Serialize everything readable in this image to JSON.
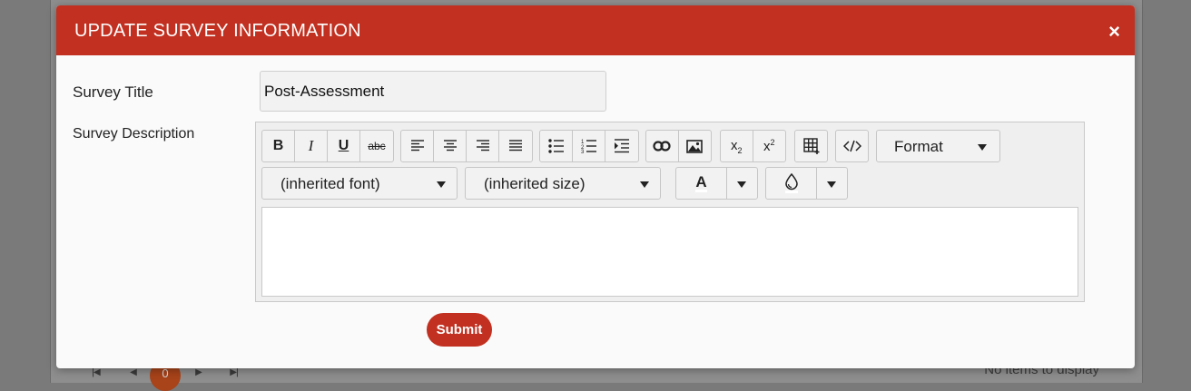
{
  "modal": {
    "title": "UPDATE SURVEY INFORMATION",
    "close_symbol": "×"
  },
  "form": {
    "survey_title_label": "Survey Title",
    "survey_title_value": "Post-Assessment",
    "survey_description_label": "Survey Description",
    "submit_label": "Submit"
  },
  "toolbar": {
    "format_label": "Format",
    "font_family_value": "(inherited font)",
    "font_size_value": "(inherited size)",
    "text_color_glyph": "A",
    "buttons": [
      {
        "name": "bold-icon"
      },
      {
        "name": "italic-icon"
      },
      {
        "name": "underline-icon"
      },
      {
        "name": "strikethrough-icon"
      },
      {
        "name": "align-left-icon"
      },
      {
        "name": "align-center-icon"
      },
      {
        "name": "align-right-icon"
      },
      {
        "name": "align-justify-icon"
      },
      {
        "name": "bulleted-list-icon"
      },
      {
        "name": "numbered-list-icon"
      },
      {
        "name": "indent-icon"
      },
      {
        "name": "link-icon"
      },
      {
        "name": "image-icon"
      },
      {
        "name": "subscript-icon"
      },
      {
        "name": "superscript-icon"
      },
      {
        "name": "table-icon"
      },
      {
        "name": "code-view-icon"
      }
    ]
  },
  "background": {
    "current_page": "0",
    "no_items_text": "No items to display"
  },
  "colors": {
    "accent": "#c13020",
    "overlay": "#7a7a7a"
  }
}
